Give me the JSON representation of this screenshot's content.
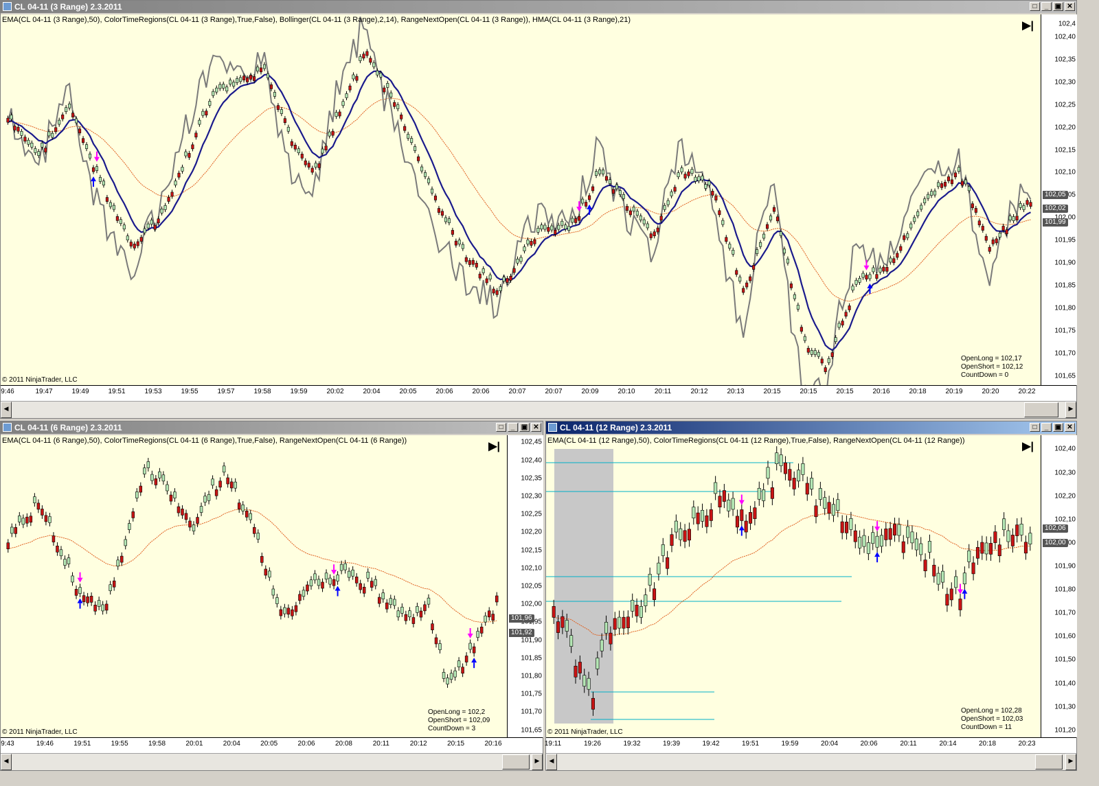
{
  "windows": [
    {
      "id": "top",
      "title": "CL 04-11 (3 Range)  2.3.2011",
      "active": false,
      "indicators": "EMA(CL 04-11 (3 Range),50), ColorTimeRegions(CL 04-11 (3 Range),True,False), Bollinger(CL 04-11 (3 Range),2,14), RangeNextOpen(CL 04-11 (3 Range)), HMA(CL 04-11 (3 Range),21)",
      "copyright": "© 2011 NinjaTrader, LLC",
      "stats": [
        "OpenLong = 102,17",
        "OpenShort = 102,12",
        "CountDown = 0"
      ],
      "y_ticks": [
        "102,40",
        "102,35",
        "102,30",
        "102,25",
        "102,20",
        "102,15",
        "102,10",
        "102,05",
        "102,00",
        "101,95",
        "101,90",
        "101,85",
        "101,80",
        "101,75",
        "101,70",
        "101,65"
      ],
      "y_top_label": "102,4",
      "y_range": [
        101.63,
        102.45
      ],
      "price_boxes": [
        "102,05",
        "102,02",
        "101,99"
      ],
      "price_box_values": [
        102.05,
        102.02,
        101.99
      ],
      "x_ticks": [
        "9:46",
        "19:47",
        "19:49",
        "19:51",
        "19:53",
        "19:55",
        "19:57",
        "19:58",
        "19:59",
        "20:02",
        "20:04",
        "20:05",
        "20:06",
        "20:06",
        "20:07",
        "20:07",
        "20:09",
        "20:10",
        "20:11",
        "20:12",
        "20:13",
        "20:15",
        "20:15",
        "20:15",
        "20:16",
        "20:18",
        "20:19",
        "20:20",
        "20:22"
      ]
    },
    {
      "id": "bl",
      "title": "CL 04-11 (6 Range)  2.3.2011",
      "active": false,
      "indicators": "EMA(CL 04-11 (6 Range),50), ColorTimeRegions(CL 04-11 (6 Range),True,False), RangeNextOpen(CL 04-11 (6 Range))",
      "copyright": "© 2011 NinjaTrader, LLC",
      "stats": [
        "OpenLong = 102,2",
        "OpenShort = 102,09",
        "CountDown = 3"
      ],
      "y_ticks": [
        "102,45",
        "102,40",
        "102,35",
        "102,30",
        "102,25",
        "102,20",
        "102,15",
        "102,10",
        "102,05",
        "102,00",
        "101,95",
        "101,90",
        "101,85",
        "101,80",
        "101,75",
        "101,70",
        "101,65"
      ],
      "y_range": [
        101.63,
        102.47
      ],
      "price_boxes": [
        "101,96",
        "101,92"
      ],
      "price_box_values": [
        101.96,
        101.92
      ],
      "x_ticks": [
        "9:43",
        "19:46",
        "19:51",
        "19:55",
        "19:58",
        "20:01",
        "20:04",
        "20:05",
        "20:06",
        "20:08",
        "20:11",
        "20:12",
        "20:15",
        "20:16"
      ]
    },
    {
      "id": "br",
      "title": "CL 04-11 (12 Range)  2.3.2011",
      "active": true,
      "indicators": "EMA(CL 04-11 (12 Range),50), ColorTimeRegions(CL 04-11 (12 Range),True,False), RangeNextOpen(CL 04-11 (12 Range))",
      "copyright": "© 2011 NinjaTrader, LLC",
      "stats": [
        "OpenLong = 102,28",
        "OpenShort = 102,03",
        "CountDown = 11"
      ],
      "y_ticks": [
        "102,40",
        "102,30",
        "102,20",
        "102,10",
        "102,00",
        "101,90",
        "101,80",
        "101,70",
        "101,60",
        "101,50",
        "101,40",
        "101,30",
        "101,20"
      ],
      "y_range": [
        101.17,
        102.46
      ],
      "price_boxes": [
        "102,06",
        "102,00"
      ],
      "price_box_values": [
        102.06,
        102.0
      ],
      "x_ticks": [
        "19:11",
        "19:26",
        "19:32",
        "19:39",
        "19:42",
        "19:51",
        "19:59",
        "20:04",
        "20:06",
        "20:11",
        "20:14",
        "20:18",
        "20:23"
      ]
    }
  ],
  "colors": {
    "bg": "#ffffe0",
    "up": "#b4e6b4",
    "down": "#c81414",
    "ema": "#e06020",
    "hma": "#1a1a8c",
    "bollinger": "#7a7a7a",
    "long_arrow": "#0000ff",
    "short_arrow": "#ff00ff",
    "signal": "#c81414",
    "hline": "#00b0c8",
    "region": "#c8c8c8"
  },
  "icons": {
    "skip": "skip-to-end-icon",
    "minimize": "minimize-icon",
    "maximize": "maximize-icon",
    "close": "close-icon",
    "restore": "restore-icon"
  }
}
